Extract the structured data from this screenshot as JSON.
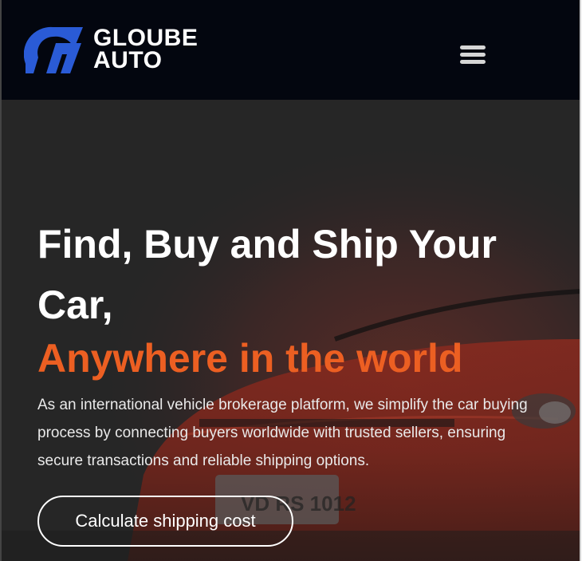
{
  "header": {
    "brand_line1": "GLOUBE",
    "brand_line2": "AUTO",
    "logo_icon": "gloube-logo-mark",
    "menu_icon": "hamburger-menu-icon",
    "background_color": "#03060f",
    "logo_color": "#2a5bd6"
  },
  "hero": {
    "title": "Find, Buy and Ship Your Car,",
    "accent": "Anywhere in the world",
    "description": "As an international vehicle brokerage platform, we simplify the car buying process by connecting buyers worldwide with trusted sellers, ensuring secure transactions and reliable shipping options.",
    "cta_label": "Calculate shipping cost",
    "plate_text": "VD RS 1012",
    "accent_color": "#ec5f22",
    "background_image": "red-sports-car-photo"
  }
}
